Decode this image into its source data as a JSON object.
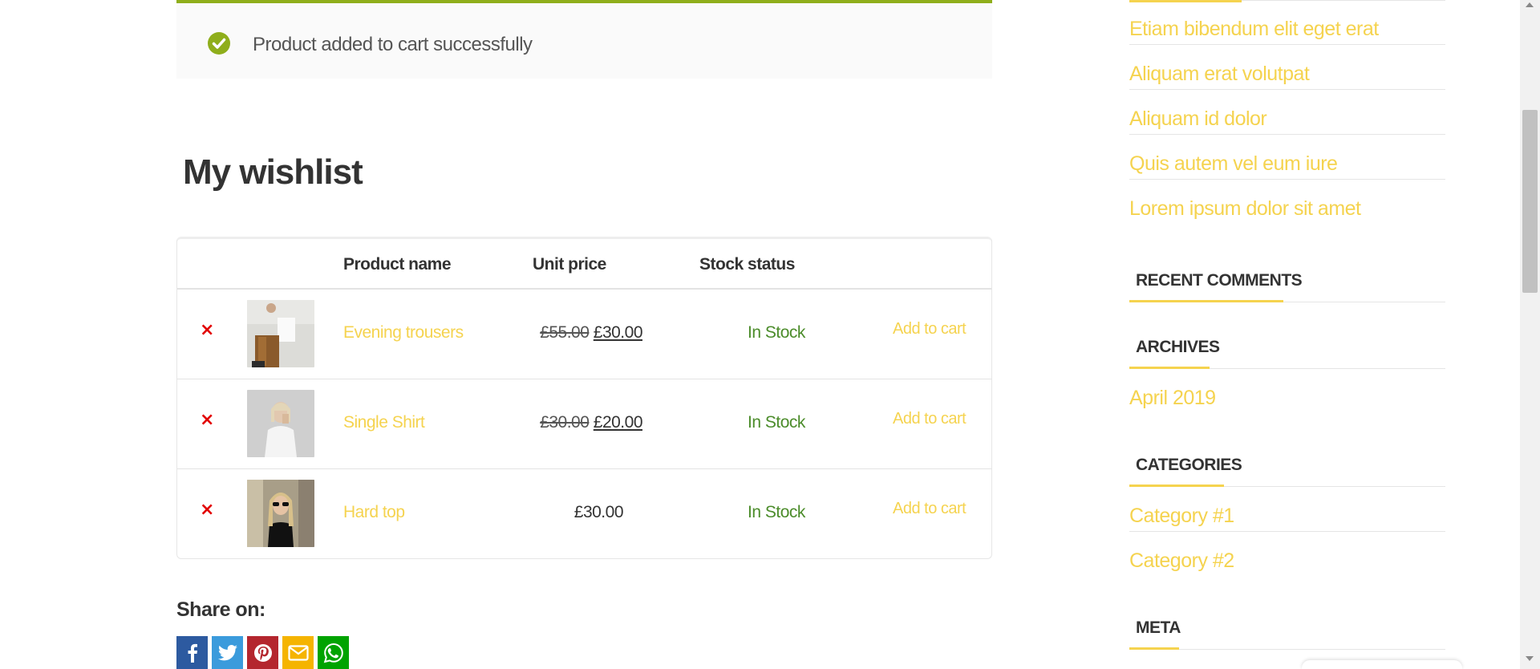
{
  "notice": {
    "text": "Product added to cart successfully",
    "icon": "check-circle-icon"
  },
  "page": {
    "title": "My wishlist"
  },
  "wishlist": {
    "headers": {
      "product_name": "Product name",
      "unit_price": "Unit price",
      "stock_status": "Stock status"
    },
    "rows": [
      {
        "remove": "×",
        "name": "Evening trousers",
        "old_price": "£55.00",
        "price": "£30.00",
        "stock": "In Stock",
        "action": "Add to cart"
      },
      {
        "remove": "×",
        "name": "Single Shirt",
        "old_price": "£30.00",
        "price": "£20.00",
        "stock": "In Stock",
        "action": "Add to cart"
      },
      {
        "remove": "×",
        "name": "Hard top",
        "old_price": "",
        "price": "£30.00",
        "stock": "In Stock",
        "action": "Add to cart"
      }
    ]
  },
  "share": {
    "title": "Share on:",
    "buttons": [
      {
        "icon": "facebook-icon",
        "color": "#2d5aa0"
      },
      {
        "icon": "twitter-icon",
        "color": "#3b9bdc"
      },
      {
        "icon": "pinterest-icon",
        "color": "#b4262e"
      },
      {
        "icon": "email-icon",
        "color": "#f5b400"
      },
      {
        "icon": "whatsapp-icon",
        "color": "#00a300"
      }
    ]
  },
  "sidebar": {
    "recent_posts": [
      "Etiam bibendum elit eget erat",
      "Aliquam erat volutpat",
      "Aliquam id dolor",
      "Quis autem vel eum iure",
      "Lorem ipsum dolor sit amet"
    ],
    "recent_comments_title": "RECENT COMMENTS",
    "archives_title": "ARCHIVES",
    "archives": [
      "April 2019"
    ],
    "categories_title": "CATEGORIES",
    "categories": [
      "Category #1",
      "Category #2"
    ],
    "meta_title": "META"
  },
  "colors": {
    "accent": "#f5d34f",
    "success": "#8fae1b",
    "remove": "#e20000",
    "stock": "#4b8c2a"
  }
}
